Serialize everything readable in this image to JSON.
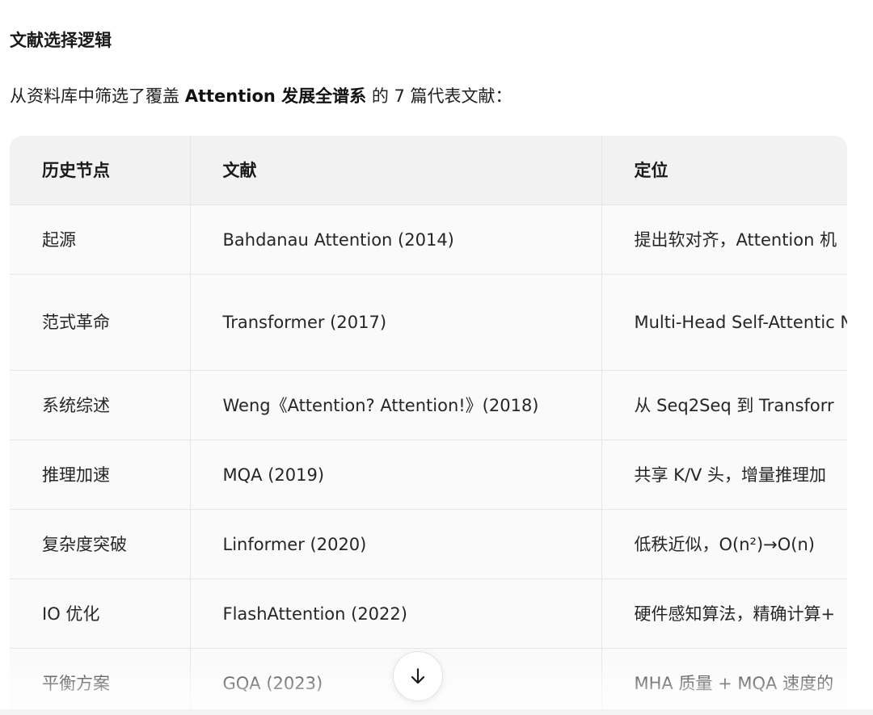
{
  "section": {
    "heading": "文献选择逻辑",
    "intro_prefix": "从资料库中筛选了覆盖 ",
    "intro_bold": "Attention 发展全谱系",
    "intro_suffix": " 的 7 篇代表文献："
  },
  "table": {
    "headers": [
      "历史节点",
      "文献",
      "定位"
    ],
    "rows": [
      [
        "起源",
        "Bahdanau Attention (2014)",
        "提出软对齐，Attention 机"
      ],
      [
        "范式革命",
        "Transformer (2017)",
        "Multi-Head Self-Attentic NN"
      ],
      [
        "系统综述",
        "Weng《Attention? Attention!》(2018)",
        "从 Seq2Seq 到 Transforr"
      ],
      [
        "推理加速",
        "MQA (2019)",
        "共享 K/V 头，增量推理加"
      ],
      [
        "复杂度突破",
        "Linformer (2020)",
        "低秩近似，O(n²)→O(n)"
      ],
      [
        "IO 优化",
        "FlashAttention (2022)",
        "硬件感知算法，精确计算+"
      ],
      [
        "平衡方案",
        "GQA (2023)",
        "MHA 质量 + MQA 速度的"
      ]
    ]
  },
  "controls": {
    "scroll_down_icon": "arrow-down-icon"
  }
}
